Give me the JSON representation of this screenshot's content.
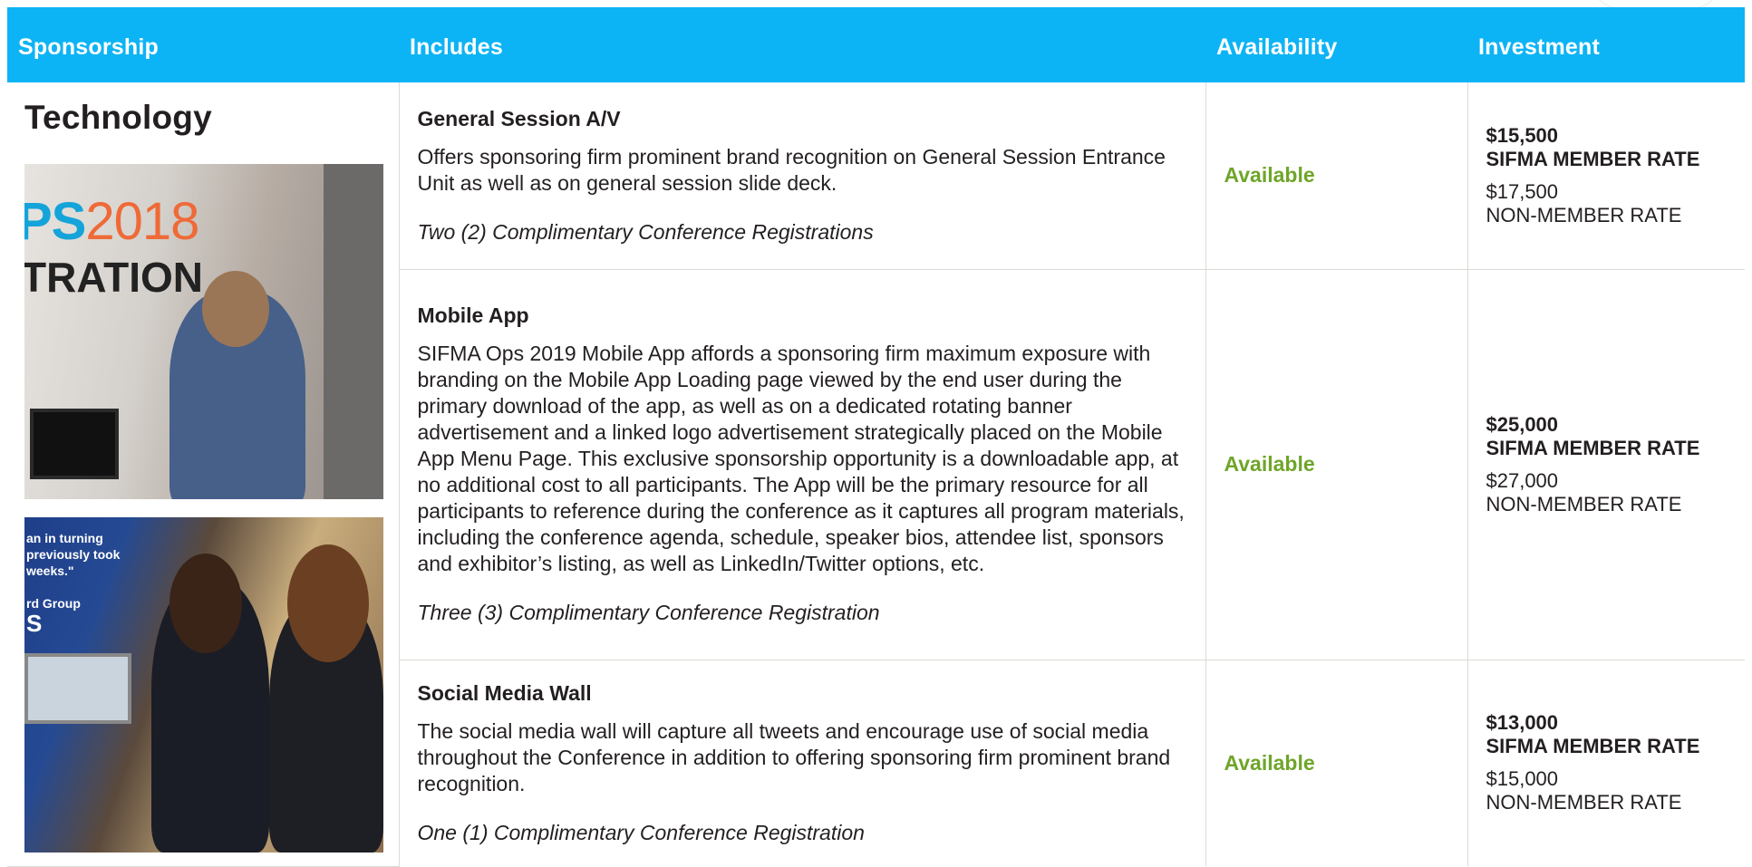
{
  "header": {
    "col_sponsorship": "Sponsorship",
    "col_includes": "Includes",
    "col_availability": "Availability",
    "col_investment": "Investment"
  },
  "category": {
    "title": "Technology",
    "photo1": {
      "text_top": "PS",
      "text_year": "2018",
      "text_bottom": "TRATION"
    },
    "photo2": {
      "text_lines": [
        "an in turning",
        "previously took",
        "weeks.\"",
        "",
        "rd Group"
      ],
      "text_big": "S"
    }
  },
  "items": [
    {
      "name": "General Session A/V",
      "description": "Offers sponsoring firm prominent brand recognition on General Session Entrance Unit as well as on general session slide deck.",
      "registrations": "Two (2) Complimentary Conference Registrations",
      "availability": "Available",
      "member_price": "$15,500",
      "member_label": "SIFMA MEMBER RATE",
      "nonmember_price": "$17,500",
      "nonmember_label": "NON-MEMBER RATE"
    },
    {
      "name": "Mobile App",
      "description": "SIFMA Ops 2019 Mobile App affords a sponsoring firm maximum exposure with branding on the Mobile App Loading page viewed by the end user during the primary download of the app, as well as on a dedicated rotating banner advertisement and a linked logo advertisement strategically placed on the Mobile App Menu Page. This exclusive sponsorship opportunity is a downloadable app, at no additional cost to all participants. The App will be the primary resource for all participants to reference during the conference as it captures all program materials, including the conference agenda, schedule, speaker bios, attendee list, sponsors and exhibitor’s listing, as well as LinkedIn/Twitter options, etc.",
      "registrations": "Three (3) Complimentary Conference Registration",
      "availability": "Available",
      "member_price": "$25,000",
      "member_label": "SIFMA MEMBER RATE",
      "nonmember_price": "$27,000",
      "nonmember_label": "NON-MEMBER RATE"
    },
    {
      "name": "Social Media Wall",
      "description": "The social media wall will capture all tweets and encourage use of social media throughout the Conference in addition to offering sponsoring firm prominent brand recognition.",
      "registrations": "One (1) Complimentary Conference Registration",
      "availability": "Available",
      "member_price": "$13,000",
      "member_label": "SIFMA MEMBER RATE",
      "nonmember_price": "$15,000",
      "nonmember_label": "NON-MEMBER RATE"
    }
  ],
  "colors": {
    "header_bg": "#0db4f5",
    "available": "#6fa52a",
    "text": "#231f20",
    "border": "#d9dcd3"
  }
}
